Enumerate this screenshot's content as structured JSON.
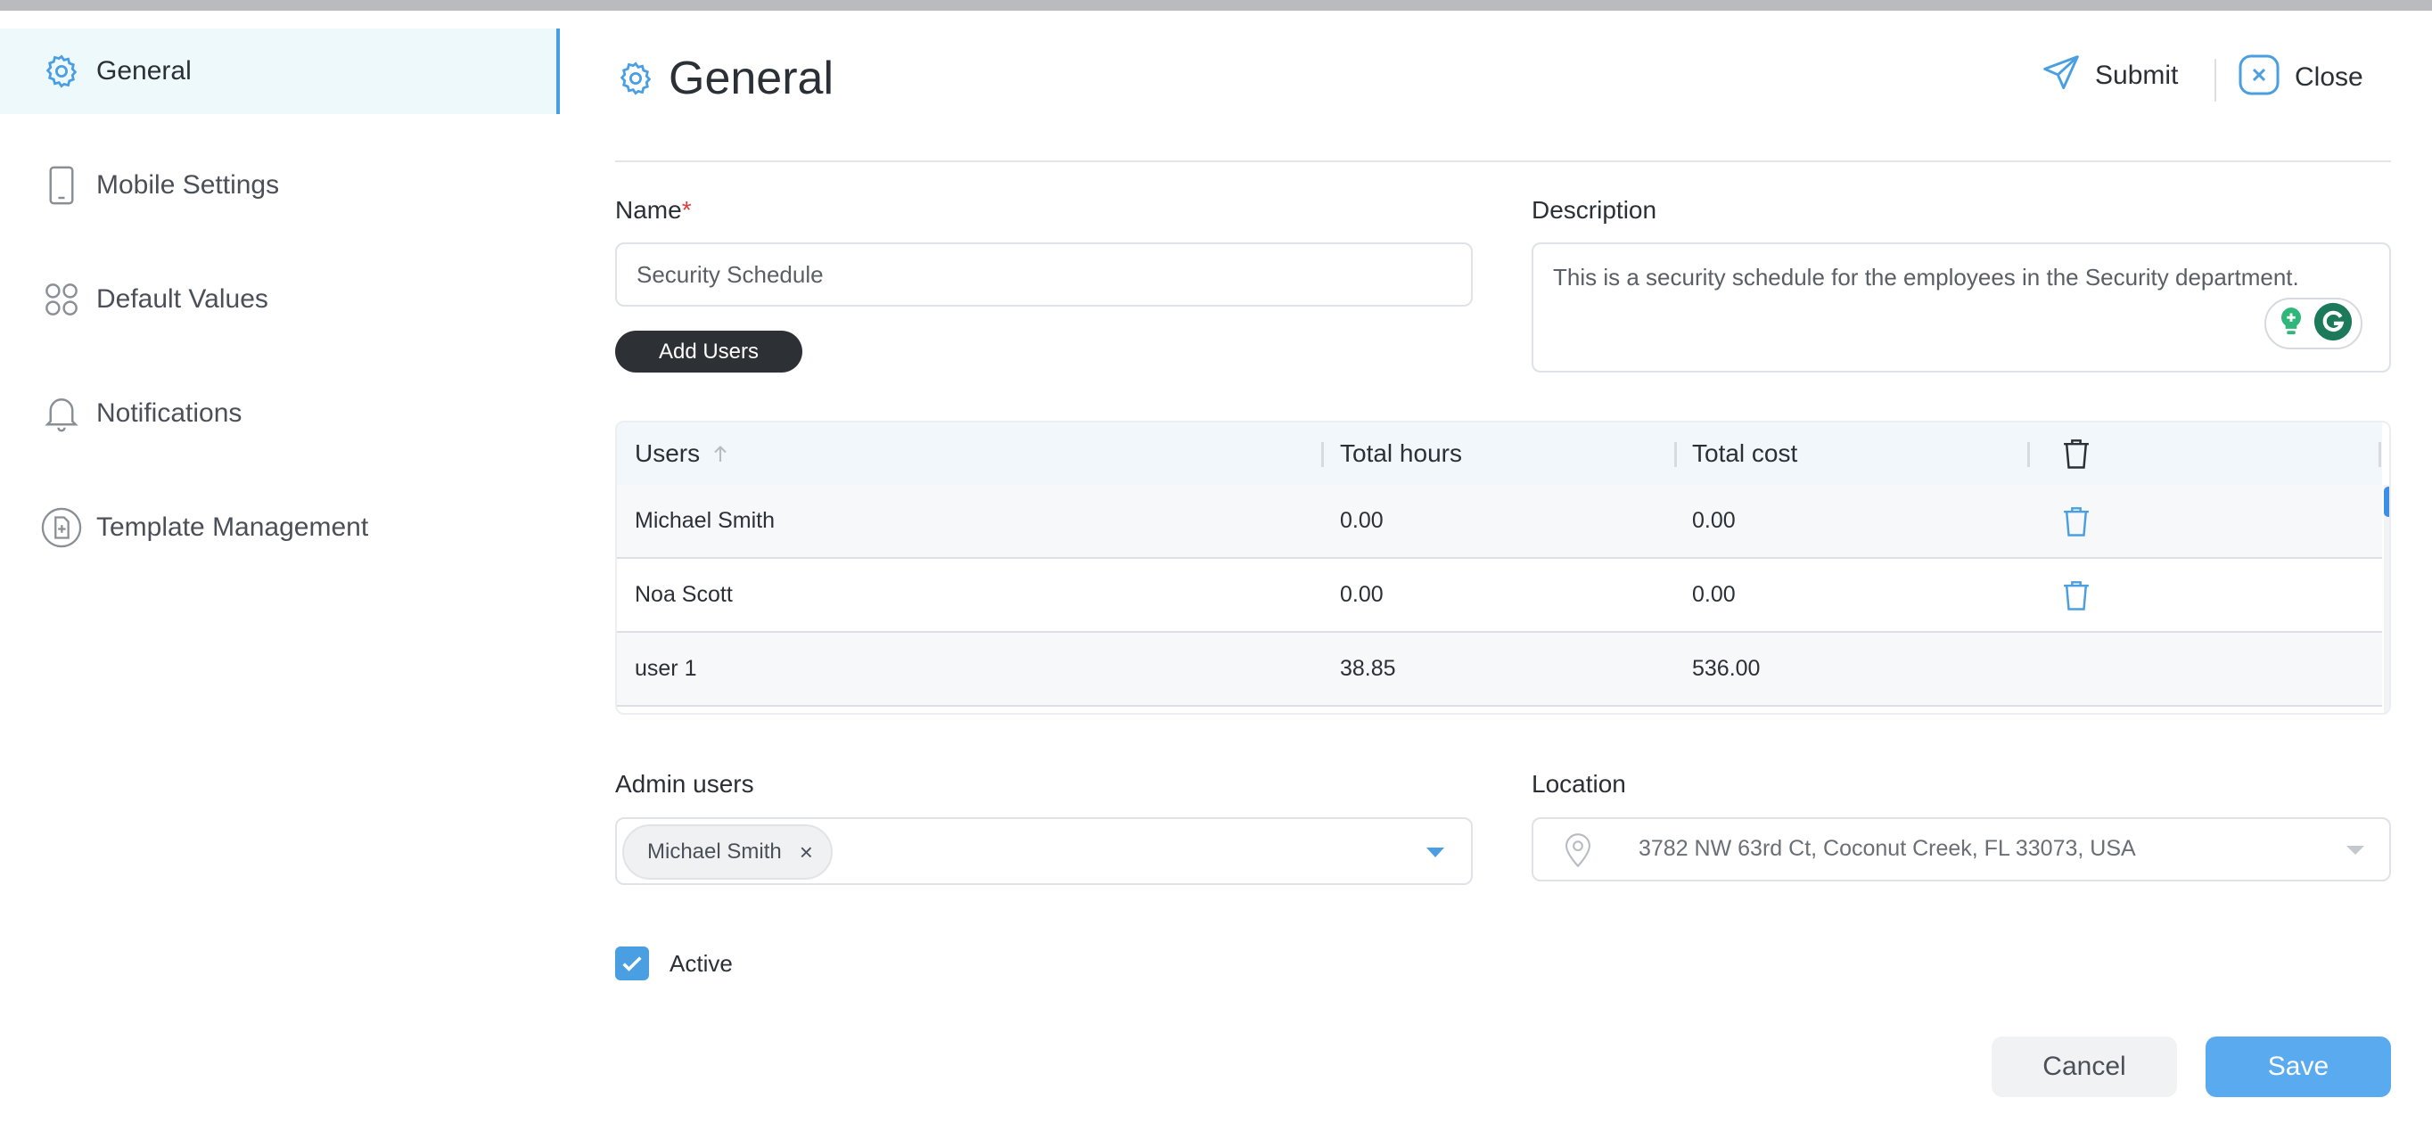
{
  "sidebar": {
    "items": [
      {
        "label": "General",
        "icon": "gear-icon",
        "active": true
      },
      {
        "label": "Mobile Settings",
        "icon": "phone-icon"
      },
      {
        "label": "Default Values",
        "icon": "grid-circles-icon"
      },
      {
        "label": "Notifications",
        "icon": "bell-icon"
      },
      {
        "label": "Template Management",
        "icon": "template-icon"
      }
    ]
  },
  "header": {
    "title": "General",
    "submit_label": "Submit",
    "close_label": "Close"
  },
  "form": {
    "name_label": "Name",
    "name_required_mark": "*",
    "name_value": "Security Schedule",
    "description_label": "Description",
    "description_value": "This is a security schedule for the employees in the Security department.",
    "add_users_label": "Add Users",
    "admin_users_label": "Admin users",
    "admin_users_selected": [
      "Michael Smith"
    ],
    "location_label": "Location",
    "location_value": "3782 NW 63rd Ct, Coconut Creek, FL 33073, USA",
    "active_label": "Active",
    "active_checked": true
  },
  "table": {
    "headers": [
      "Users",
      "Total hours",
      "Total cost"
    ],
    "rows": [
      {
        "user": "Michael Smith",
        "hours": "0.00",
        "cost": "0.00",
        "deletable": true
      },
      {
        "user": "Noa Scott",
        "hours": "0.00",
        "cost": "0.00",
        "deletable": true
      },
      {
        "user": "user 1",
        "hours": "38.85",
        "cost": "536.00",
        "deletable": false
      }
    ]
  },
  "footer": {
    "cancel_label": "Cancel",
    "save_label": "Save"
  },
  "colors": {
    "accent": "#4a9fe3",
    "save": "#5aaaf0",
    "dark_button": "#2d3135",
    "required": "#e23b3b"
  }
}
